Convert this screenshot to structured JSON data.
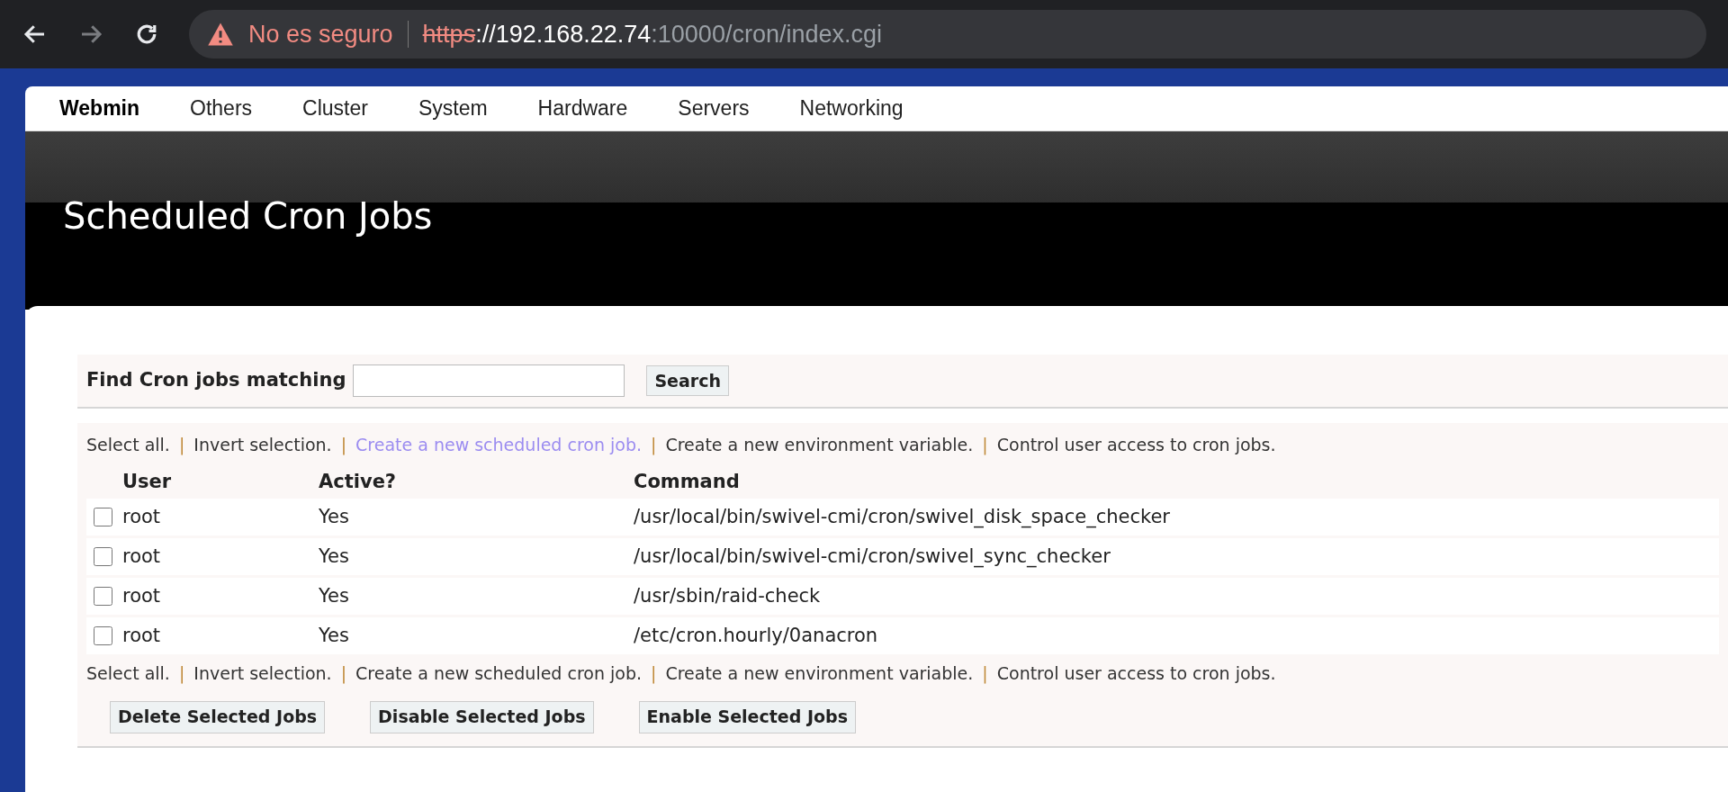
{
  "browser": {
    "security_label": "No es seguro",
    "url_scheme": "https",
    "url_host": "://192.168.22.74",
    "url_rest": ":10000/cron/index.cgi"
  },
  "nav": [
    {
      "label": "Webmin",
      "selected": true
    },
    {
      "label": "Others",
      "selected": false
    },
    {
      "label": "Cluster",
      "selected": false
    },
    {
      "label": "System",
      "selected": false
    },
    {
      "label": "Hardware",
      "selected": false
    },
    {
      "label": "Servers",
      "selected": false
    },
    {
      "label": "Networking",
      "selected": false
    }
  ],
  "title": "Scheduled Cron Jobs",
  "search": {
    "label": "Find Cron jobs matching",
    "button": "Search"
  },
  "links_top": [
    {
      "label": "Select all.",
      "hovered": false
    },
    {
      "label": "Invert selection.",
      "hovered": false
    },
    {
      "label": "Create a new scheduled cron job.",
      "hovered": true
    },
    {
      "label": "Create a new environment variable.",
      "hovered": false
    },
    {
      "label": "Control user access to cron jobs.",
      "hovered": false
    }
  ],
  "separator": "|",
  "table": {
    "columns": [
      "User",
      "Active?",
      "Command"
    ],
    "rows": [
      {
        "user": "root",
        "active": "Yes",
        "command": "/usr/local/bin/swivel-cmi/cron/swivel_disk_space_checker",
        "checked": false
      },
      {
        "user": "root",
        "active": "Yes",
        "command": "/usr/local/bin/swivel-cmi/cron/swivel_sync_checker",
        "checked": false
      },
      {
        "user": "root",
        "active": "Yes",
        "command": "/usr/sbin/raid-check",
        "checked": false
      },
      {
        "user": "root",
        "active": "Yes",
        "command": "/etc/cron.hourly/0anacron",
        "checked": false
      }
    ]
  },
  "links_bottom": [
    {
      "label": "Select all.",
      "hovered": false
    },
    {
      "label": "Invert selection.",
      "hovered": false
    },
    {
      "label": "Create a new scheduled cron job.",
      "hovered": false
    },
    {
      "label": "Create a new environment variable.",
      "hovered": false
    },
    {
      "label": "Control user access to cron jobs.",
      "hovered": false
    }
  ],
  "buttons": [
    "Delete Selected Jobs",
    "Disable Selected Jobs",
    "Enable Selected Jobs"
  ]
}
